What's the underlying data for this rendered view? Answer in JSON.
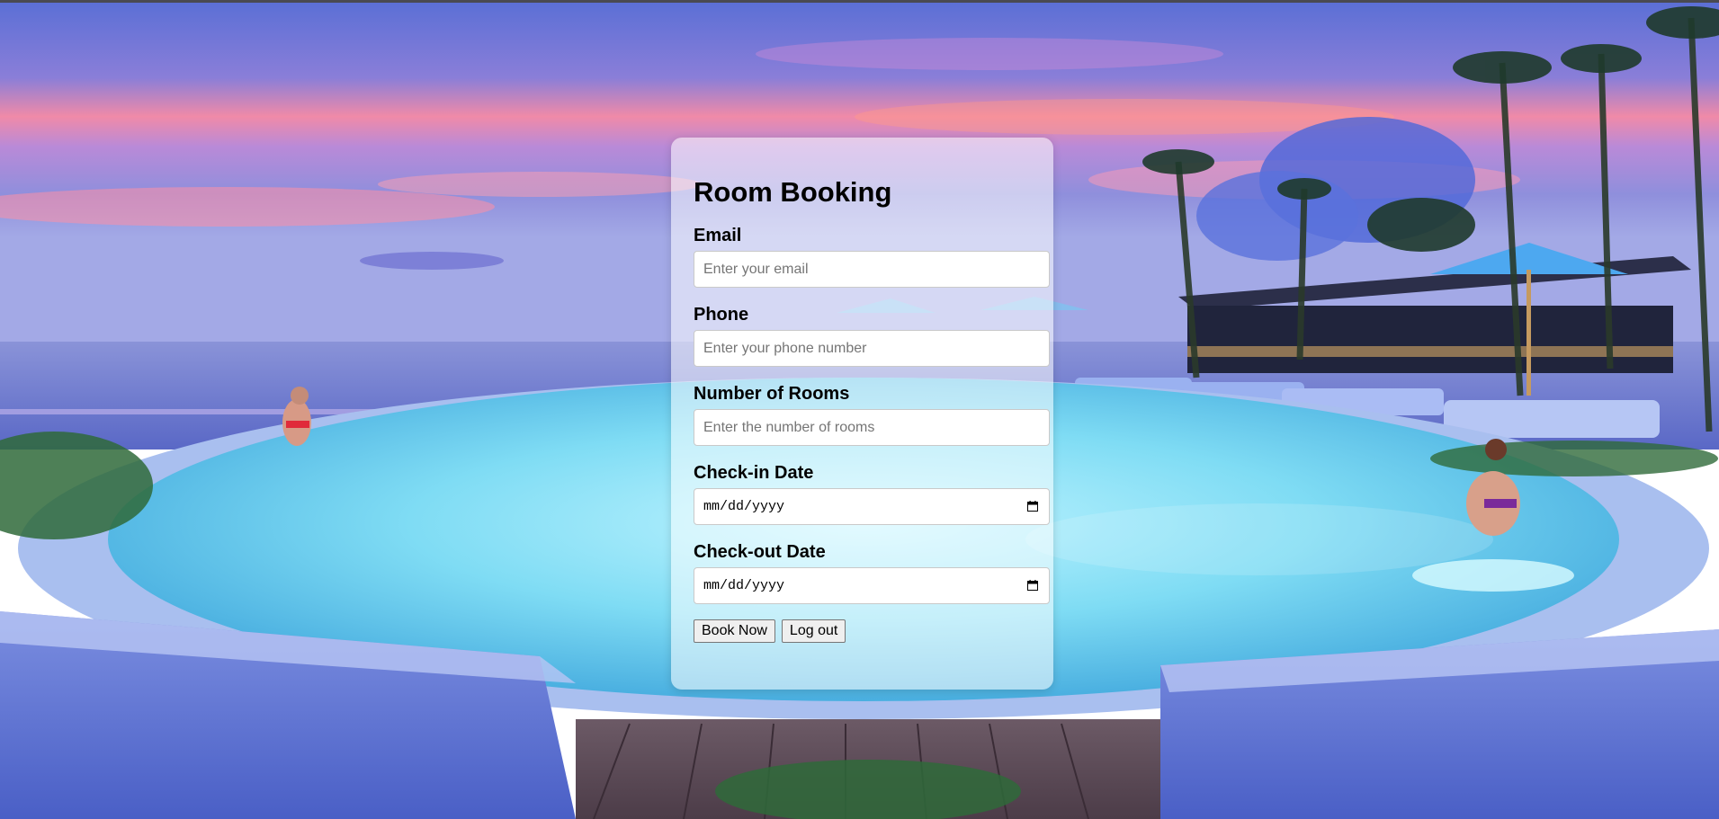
{
  "form": {
    "title": "Room Booking",
    "fields": {
      "email": {
        "label": "Email",
        "placeholder": "Enter your email"
      },
      "phone": {
        "label": "Phone",
        "placeholder": "Enter your phone number"
      },
      "rooms": {
        "label": "Number of Rooms",
        "placeholder": "Enter the number of rooms"
      },
      "checkin": {
        "label": "Check-in Date",
        "value": "mm/dd/yyyy",
        "icon": "calendar-icon"
      },
      "checkout": {
        "label": "Check-out Date",
        "value": "mm/dd/yyyy",
        "icon": "calendar-icon"
      }
    },
    "buttons": {
      "book": "Book Now",
      "logout": "Log out"
    }
  },
  "colors": {
    "sky_top": "#4f6fd0",
    "sky_pink": "#f27aa0",
    "pool": "#6fd3f0",
    "card_bg": "rgba(255,255,255,0.55)"
  }
}
